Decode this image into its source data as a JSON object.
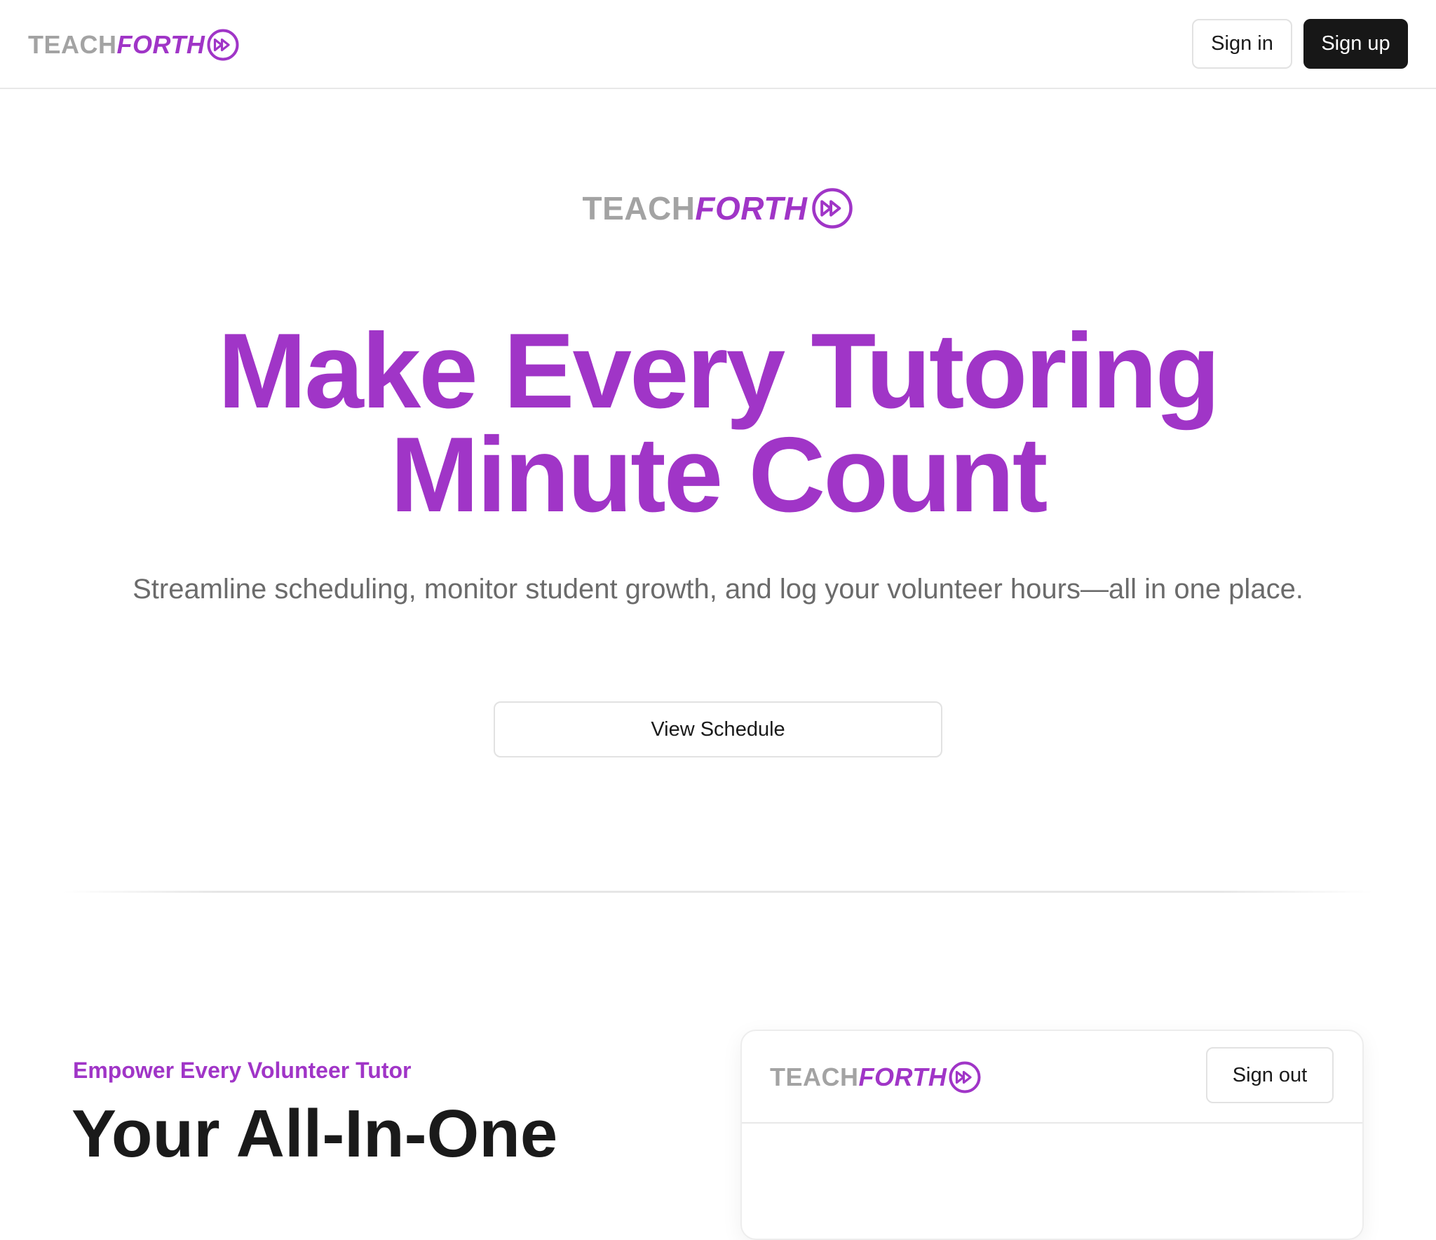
{
  "brand": {
    "part1": "TEACH",
    "part2": "FORTH",
    "icon": "fast-forward-circle-icon",
    "accent_color": "#a035c7",
    "muted_color": "#a3a3a3"
  },
  "header": {
    "signin_label": "Sign in",
    "signup_label": "Sign up"
  },
  "hero": {
    "title_line1": "Make Every Tutoring",
    "title_line2": "Minute Count",
    "subtitle": "Streamline scheduling, monitor student growth, and log your volunteer hours—all in one place.",
    "cta_label": "View Schedule"
  },
  "features": {
    "eyebrow": "Empower Every Volunteer Tutor",
    "heading": "Your All-In-One"
  },
  "preview": {
    "signout_label": "Sign out"
  }
}
